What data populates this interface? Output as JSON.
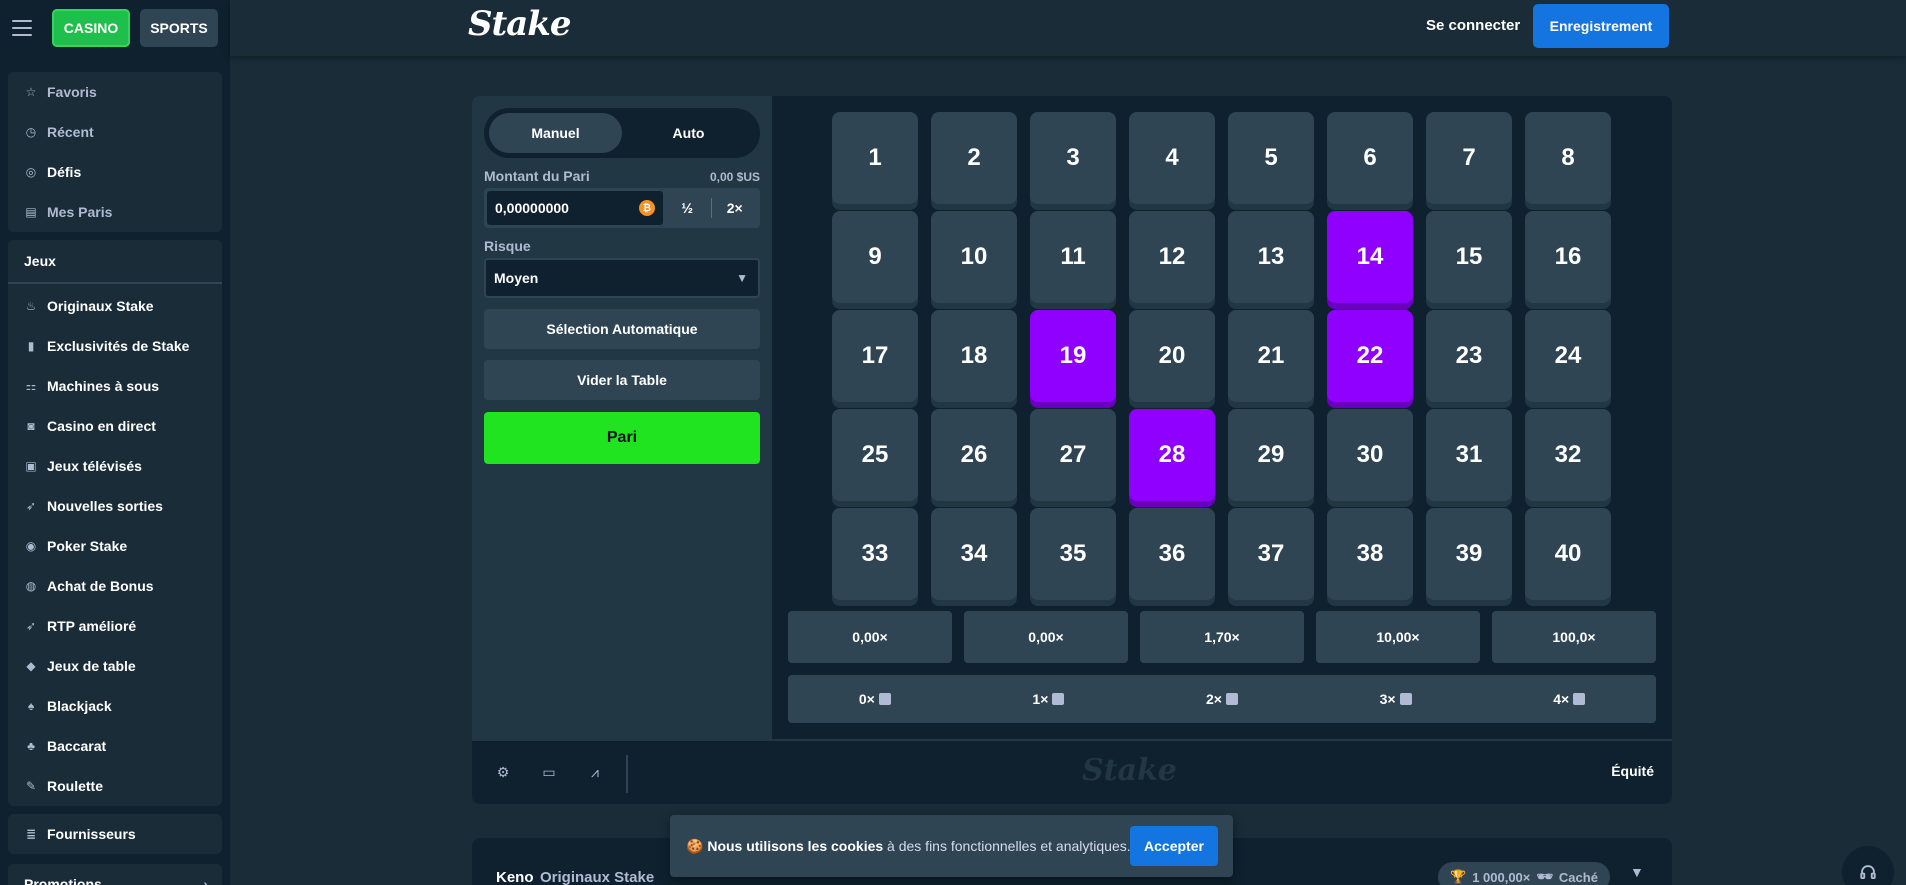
{
  "header": {
    "casino_label": "CASINO",
    "sports_label": "SPORTS",
    "logo": "Stake",
    "login_label": "Se connecter",
    "register_label": "Enregistrement"
  },
  "sidebar": {
    "top_items": [
      {
        "label": "Favoris",
        "icon": "star-icon"
      },
      {
        "label": "Récent",
        "icon": "clock-icon"
      },
      {
        "label": "Défis",
        "icon": "target-icon"
      },
      {
        "label": "Mes Paris",
        "icon": "receipt-icon"
      }
    ],
    "section_title": "Jeux",
    "game_items": [
      {
        "label": "Originaux Stake",
        "icon": "flame-icon"
      },
      {
        "label": "Exclusivités de Stake",
        "icon": "bookmark-icon"
      },
      {
        "label": "Machines à sous",
        "icon": "slots-icon"
      },
      {
        "label": "Casino en direct",
        "icon": "live-icon"
      },
      {
        "label": "Jeux télévisés",
        "icon": "gift-icon"
      },
      {
        "label": "Nouvelles sorties",
        "icon": "rocket-icon"
      },
      {
        "label": "Poker Stake",
        "icon": "chip-icon"
      },
      {
        "label": "Achat de Bonus",
        "icon": "bonus-icon"
      },
      {
        "label": "RTP amélioré",
        "icon": "rocket-icon"
      },
      {
        "label": "Jeux de table",
        "icon": "drop-icon"
      },
      {
        "label": "Blackjack",
        "icon": "spade-icon"
      },
      {
        "label": "Baccarat",
        "icon": "cards-icon"
      },
      {
        "label": "Roulette",
        "icon": "roulette-icon"
      }
    ],
    "providers_label": "Fournisseurs",
    "promotions_label": "Promotions"
  },
  "panel": {
    "tab_manual": "Manuel",
    "tab_auto": "Auto",
    "bet_label": "Montant du Pari",
    "bet_usd": "0,00 $US",
    "bet_value": "0,00000000",
    "half_label": "½",
    "double_label": "2×",
    "risk_label": "Risque",
    "risk_value": "Moyen",
    "auto_pick_label": "Sélection Automatique",
    "clear_label": "Vider la Table",
    "bet_button_label": "Pari"
  },
  "board": {
    "numbers": [
      "1",
      "2",
      "3",
      "4",
      "5",
      "6",
      "7",
      "8",
      "9",
      "10",
      "11",
      "12",
      "13",
      "14",
      "15",
      "16",
      "17",
      "18",
      "19",
      "20",
      "21",
      "22",
      "23",
      "24",
      "25",
      "26",
      "27",
      "28",
      "29",
      "30",
      "31",
      "32",
      "33",
      "34",
      "35",
      "36",
      "37",
      "38",
      "39",
      "40"
    ],
    "selected": [
      14,
      19,
      22,
      28
    ],
    "selected_color": "#9000ff",
    "multipliers": [
      "0,00×",
      "0,00×",
      "1,70×",
      "10,00×",
      "100,0×"
    ],
    "hits": [
      "0×",
      "1×",
      "2×",
      "3×",
      "4×"
    ]
  },
  "footer": {
    "logo": "Stake",
    "fairness_label": "Équité"
  },
  "info": {
    "title": "Keno",
    "subtitle": "Originaux Stake",
    "badge_value": "1 000,00×",
    "badge_hidden": "Caché"
  },
  "cookie": {
    "emoji": "🍪",
    "bold": "Nous utilisons les cookies",
    "rest": " à des fins fonctionnelles et analytiques.",
    "accept_label": "Accepter"
  },
  "colors": {
    "accent_green": "#1fe41f",
    "accent_blue": "#1475e1",
    "tile": "#2f4553",
    "tile_selected": "#9000ff"
  }
}
